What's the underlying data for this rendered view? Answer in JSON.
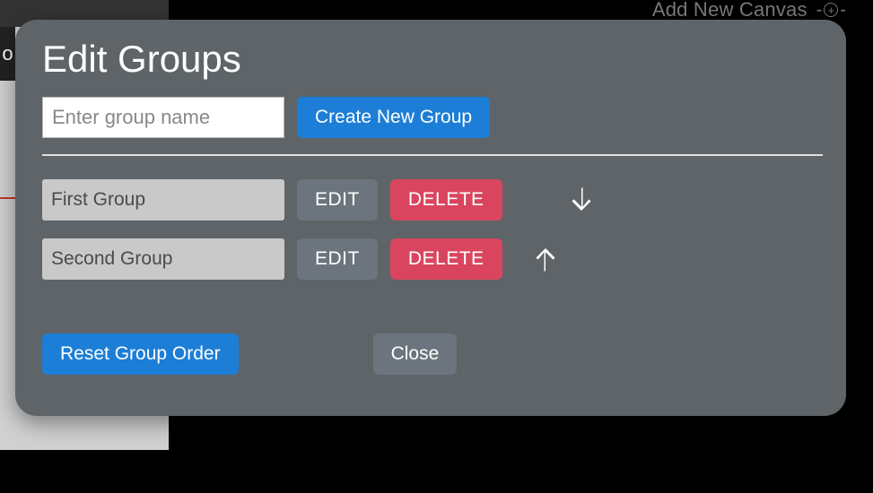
{
  "header": {
    "add_canvas_label": "Add New Canvas"
  },
  "modal": {
    "title": "Edit Groups",
    "group_name_placeholder": "Enter group name",
    "create_button": "Create New Group"
  },
  "groups": [
    {
      "name": "First Group",
      "edit": "EDIT",
      "delete": "DELETE",
      "move": "down"
    },
    {
      "name": "Second Group",
      "edit": "EDIT",
      "delete": "DELETE",
      "move": "up"
    }
  ],
  "footer": {
    "reset_label": "Reset Group Order",
    "close_label": "Close"
  }
}
